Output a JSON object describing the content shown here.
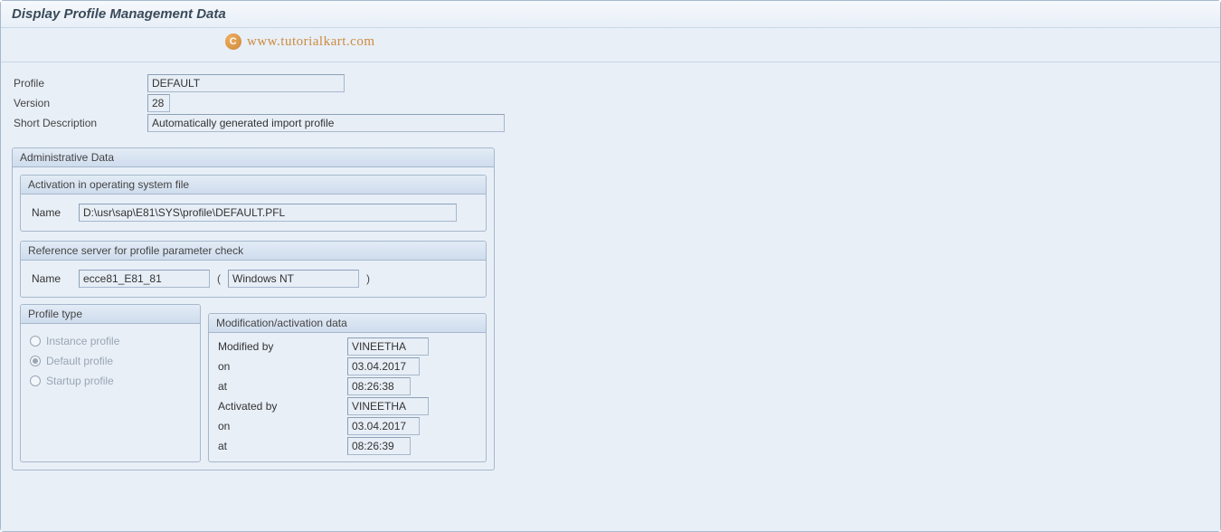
{
  "header": {
    "title": "Display Profile Management Data"
  },
  "watermark": "www.tutorialkart.com",
  "form": {
    "profile_label": "Profile",
    "profile_value": "DEFAULT",
    "version_label": "Version",
    "version_value": "28",
    "short_desc_label": "Short Description",
    "short_desc_value": "Automatically generated import profile"
  },
  "admin": {
    "legend": "Administrative Data",
    "activation_file": {
      "legend": "Activation in operating system file",
      "name_label": "Name",
      "name_value": "D:\\usr\\sap\\E81\\SYS\\profile\\DEFAULT.PFL"
    },
    "reference_server": {
      "legend": "Reference server for profile parameter check",
      "name_label": "Name",
      "name_value": "ecce81_E81_81",
      "os_value": "Windows NT"
    },
    "profile_type": {
      "legend": "Profile type",
      "instance": "Instance profile",
      "default": "Default profile",
      "startup": "Startup profile"
    },
    "modification": {
      "legend": "Modification/activation data",
      "modified_by_label": "Modified by",
      "modified_by_value": "VINEETHA",
      "on_label": "on",
      "modified_on_value": "03.04.2017",
      "at_label": "at",
      "modified_at_value": "08:26:38",
      "activated_by_label": "Activated by",
      "activated_by_value": "VINEETHA",
      "activated_on_value": "03.04.2017",
      "activated_at_value": "08:26:39"
    }
  }
}
